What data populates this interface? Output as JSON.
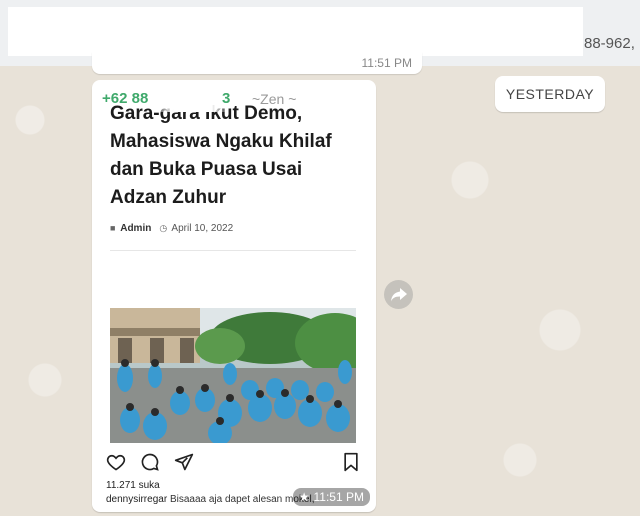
{
  "header": {
    "phone_fragment": "88-962,"
  },
  "previous_message": {
    "time": "11:51 PM"
  },
  "date_divider": "YESTERDAY",
  "message": {
    "sender_visible_prefix": "+62 88",
    "sender_visible_suffix": "3",
    "push_name": "~Zen ~",
    "article": {
      "title_lines": [
        "Gara-gara Ikut Demo,",
        "Mahasiswa Ngaku Khilaf",
        "dan Buka Puasa Usai",
        "Adzan Zuhur"
      ],
      "author": "Admin",
      "date": "April 10, 2022"
    },
    "instagram": {
      "likes": "11.271 suka",
      "caption_user": "dennysirregar",
      "caption_text": "Bisaaaa aja dapet alesan mokel,"
    },
    "time": "11:51 PM",
    "starred": true
  },
  "colors": {
    "sender_name": "#3fa96b",
    "chat_background": "#e8e2d8",
    "bubble": "#ffffff"
  },
  "icons": [
    "heart-icon",
    "comment-icon",
    "share-icon",
    "bookmark-icon",
    "star-icon",
    "forward-icon",
    "user-icon",
    "clock-icon"
  ]
}
